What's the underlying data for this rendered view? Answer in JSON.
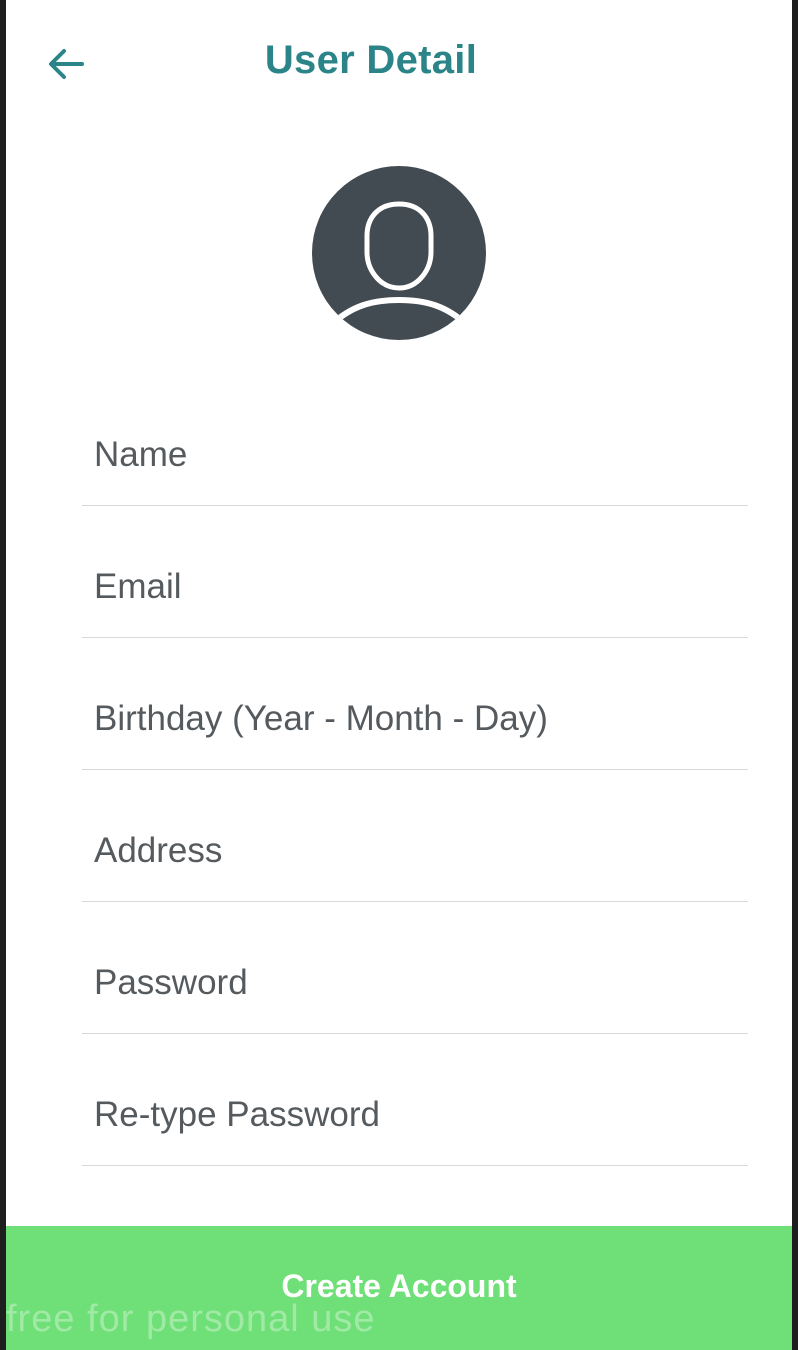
{
  "header": {
    "title": "User Detail",
    "back_icon": "arrow-left-icon"
  },
  "avatar": {
    "icon": "user-avatar-icon"
  },
  "form": {
    "fields": [
      {
        "placeholder": "Name",
        "value": ""
      },
      {
        "placeholder": "Email",
        "value": ""
      },
      {
        "placeholder": "Birthday (Year - Month - Day)",
        "value": ""
      },
      {
        "placeholder": "Address",
        "value": ""
      },
      {
        "placeholder": "Password",
        "value": ""
      },
      {
        "placeholder": "Re-type Password",
        "value": ""
      }
    ]
  },
  "actions": {
    "create_label": "Create Account"
  },
  "watermark": {
    "text": "free for personal use"
  },
  "colors": {
    "accent": "#2a8488",
    "button": "#6fdf77",
    "avatar_bg": "#424a52"
  }
}
